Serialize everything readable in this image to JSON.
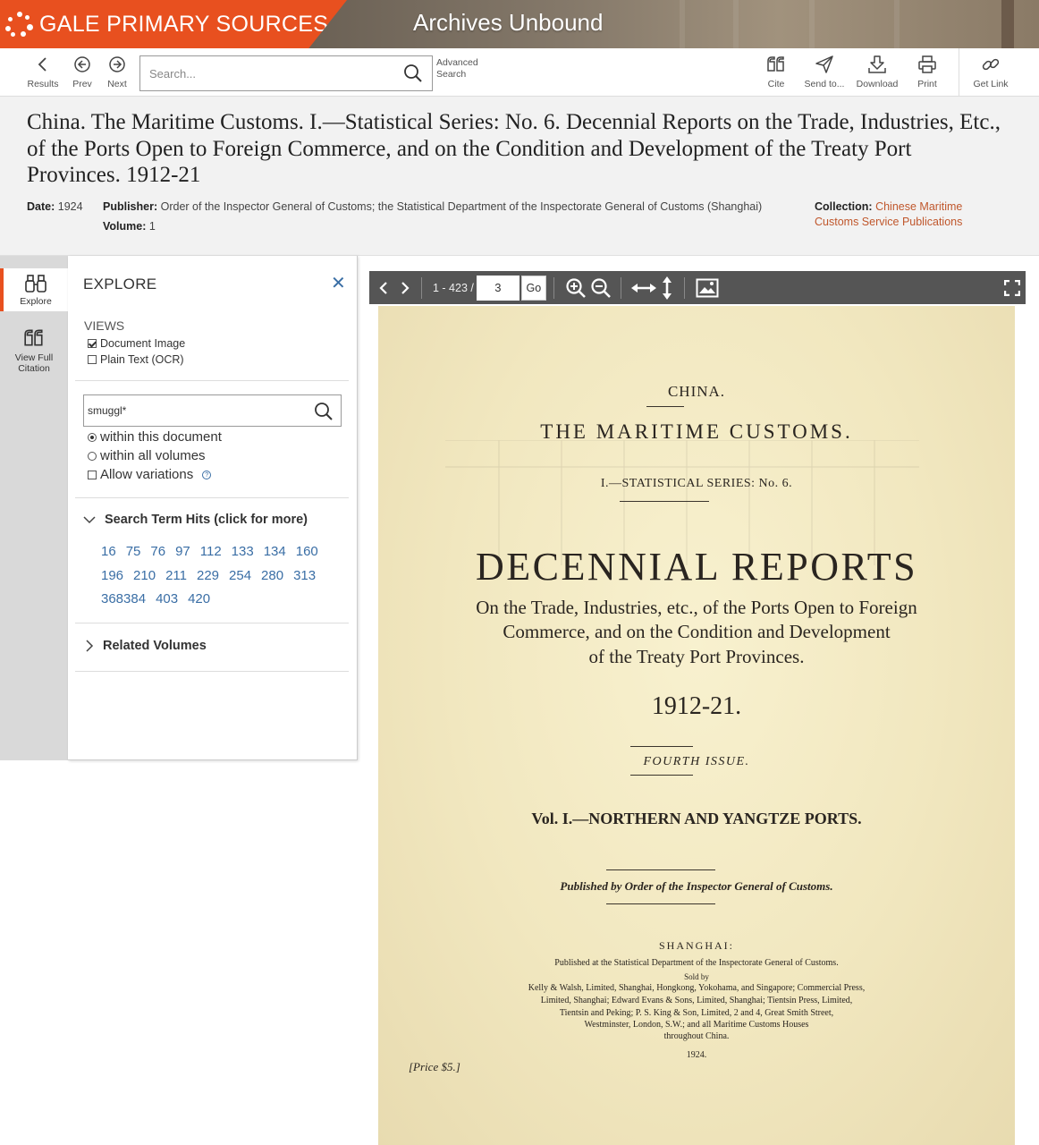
{
  "banner": {
    "brand": "GALE PRIMARY SOURCES",
    "title": "Archives Unbound"
  },
  "toolbar": {
    "results": "Results",
    "prev": "Prev",
    "next": "Next",
    "search_placeholder": "Search...",
    "advanced_search": [
      "Advanced",
      "Search"
    ],
    "cite": "Cite",
    "send_to": "Send to...",
    "download": "Download",
    "print": "Print",
    "get_link": "Get Link"
  },
  "document": {
    "title": "China. The Maritime Customs. I.—Statistical Series: No. 6. Decennial Reports on the Trade, Industries, Etc., of the Ports Open to Foreign Commerce, and on the Condition and Development of the Treaty Port Provinces. 1912-21",
    "date_label": "Date:",
    "date": "1924",
    "publisher_label": "Publisher:",
    "publisher": "Order of the Inspector General of Customs; the Statistical Department of the Inspectorate General of Customs (Shanghai)",
    "volume_label": "Volume:",
    "volume": "1",
    "collection_label": "Collection:",
    "collection": [
      "Chinese Maritime",
      "Customs Service Publications"
    ]
  },
  "rail": {
    "explore": "Explore",
    "view_full_citation": [
      "View Full",
      "Citation"
    ]
  },
  "explore": {
    "title": "EXPLORE",
    "views_heading": "VIEWS",
    "views": [
      {
        "label": "Document Image",
        "checked": true
      },
      {
        "label": "Plain Text (OCR)",
        "checked": false
      }
    ],
    "search_value": "smuggl*",
    "scope_options": [
      {
        "label": "within this document",
        "checked": true
      },
      {
        "label": "within all volumes",
        "checked": false
      }
    ],
    "allow_variations": "Allow variations",
    "hits_heading": "Search Term Hits (click for more)",
    "hits": [
      "16",
      "75",
      "76",
      "97",
      "112",
      "133",
      "134",
      "160",
      "196",
      "210",
      "211",
      "229",
      "254",
      "280",
      "313",
      "368",
      "384",
      "403",
      "420"
    ],
    "related_volumes": "Related Volumes"
  },
  "viewer": {
    "page_range": "1 - 423 /",
    "current_page": "3",
    "go": "Go"
  },
  "page_image": {
    "line1": "CHINA.",
    "line2": "THE MARITIME CUSTOMS.",
    "line3": "I.—STATISTICAL SERIES: No. 6.",
    "heading": "DECENNIAL REPORTS",
    "sub1": "On the Trade, Industries, etc., of the Ports Open to Foreign",
    "sub2": "Commerce, and on the Condition and Development",
    "sub3": "of the Treaty Port Provinces.",
    "years": "1912-21.",
    "issue": "FOURTH ISSUE.",
    "vol": "Vol. I.—NORTHERN AND YANGTZE PORTS.",
    "published_by": "Published by Order of the Inspector General of Customs.",
    "city": "SHANGHAI:",
    "imprint": [
      "Published at the Statistical Department of the Inspectorate General of Customs.",
      "Sold by",
      "Kelly & Walsh, Limited, Shanghai, Hongkong, Yokohama, and Singapore; Commercial Press,",
      "Limited, Shanghai; Edward Evans & Sons, Limited, Shanghai; Tientsin Press, Limited,",
      "Tientsin and Peking; P. S. King & Son, Limited, 2 and 4, Great Smith Street,",
      "Westminster, London, S.W.; and all Maritime Customs Houses",
      "throughout China."
    ],
    "year_foot": "1924.",
    "price": "[Price $5.]"
  }
}
